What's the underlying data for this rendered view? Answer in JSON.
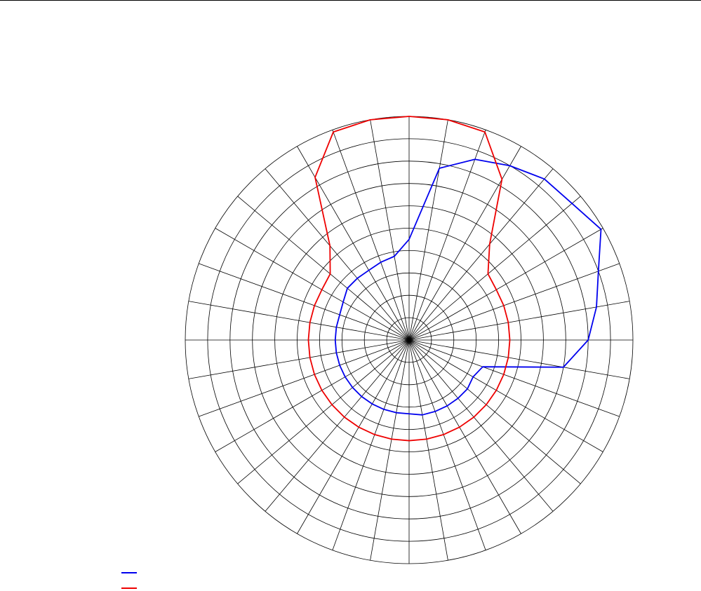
{
  "chart_data": {
    "type": "polar-line",
    "title": "",
    "theta_unit": "degrees",
    "theta_zero": "top",
    "theta_direction": "clockwise",
    "theta_step": 10,
    "r_rings": [
      1,
      2,
      3,
      4,
      5,
      6,
      7,
      8,
      9,
      10
    ],
    "r_max": 10,
    "grid": true,
    "legend_position": "bottom-left",
    "series": [
      {
        "name": "",
        "color": "#0000ee",
        "points": [
          {
            "theta": 0,
            "r": 4.5
          },
          {
            "theta": 10,
            "r": 7.8
          },
          {
            "theta": 20,
            "r": 8.6
          },
          {
            "theta": 30,
            "r": 9.0
          },
          {
            "theta": 40,
            "r": 9.4
          },
          {
            "theta": 50,
            "r": 9.5
          },
          {
            "theta": 60,
            "r": 9.9
          },
          {
            "theta": 70,
            "r": 9.0
          },
          {
            "theta": 80,
            "r": 8.5
          },
          {
            "theta": 90,
            "r": 8.0
          },
          {
            "theta": 100,
            "r": 7.0
          },
          {
            "theta": 110,
            "r": 3.5
          },
          {
            "theta": 120,
            "r": 3.3
          },
          {
            "theta": 130,
            "r": 3.4
          },
          {
            "theta": 140,
            "r": 3.4
          },
          {
            "theta": 150,
            "r": 3.4
          },
          {
            "theta": 160,
            "r": 3.4
          },
          {
            "theta": 170,
            "r": 3.4
          },
          {
            "theta": 180,
            "r": 3.3
          },
          {
            "theta": 190,
            "r": 3.3
          },
          {
            "theta": 200,
            "r": 3.3
          },
          {
            "theta": 210,
            "r": 3.3
          },
          {
            "theta": 220,
            "r": 3.3
          },
          {
            "theta": 230,
            "r": 3.3
          },
          {
            "theta": 240,
            "r": 3.3
          },
          {
            "theta": 250,
            "r": 3.3
          },
          {
            "theta": 260,
            "r": 3.3
          },
          {
            "theta": 270,
            "r": 3.3
          },
          {
            "theta": 280,
            "r": 3.3
          },
          {
            "theta": 290,
            "r": 3.3
          },
          {
            "theta": 300,
            "r": 3.4
          },
          {
            "theta": 310,
            "r": 3.6
          },
          {
            "theta": 320,
            "r": 3.6
          },
          {
            "theta": 330,
            "r": 3.6
          },
          {
            "theta": 340,
            "r": 3.7
          },
          {
            "theta": 350,
            "r": 3.8
          }
        ]
      },
      {
        "name": "",
        "color": "#ee0000",
        "points": [
          {
            "theta": 0,
            "r": 10.0
          },
          {
            "theta": 10,
            "r": 10.0
          },
          {
            "theta": 20,
            "r": 9.9
          },
          {
            "theta": 30,
            "r": 8.3
          },
          {
            "theta": 40,
            "r": 5.6
          },
          {
            "theta": 50,
            "r": 4.6
          },
          {
            "theta": 60,
            "r": 4.5
          },
          {
            "theta": 70,
            "r": 4.5
          },
          {
            "theta": 80,
            "r": 4.5
          },
          {
            "theta": 90,
            "r": 4.5
          },
          {
            "theta": 100,
            "r": 4.5
          },
          {
            "theta": 110,
            "r": 4.5
          },
          {
            "theta": 120,
            "r": 4.5
          },
          {
            "theta": 130,
            "r": 4.5
          },
          {
            "theta": 140,
            "r": 4.5
          },
          {
            "theta": 150,
            "r": 4.5
          },
          {
            "theta": 160,
            "r": 4.5
          },
          {
            "theta": 170,
            "r": 4.5
          },
          {
            "theta": 180,
            "r": 4.5
          },
          {
            "theta": 190,
            "r": 4.5
          },
          {
            "theta": 200,
            "r": 4.5
          },
          {
            "theta": 210,
            "r": 4.5
          },
          {
            "theta": 220,
            "r": 4.5
          },
          {
            "theta": 230,
            "r": 4.5
          },
          {
            "theta": 240,
            "r": 4.5
          },
          {
            "theta": 250,
            "r": 4.5
          },
          {
            "theta": 260,
            "r": 4.5
          },
          {
            "theta": 270,
            "r": 4.5
          },
          {
            "theta": 280,
            "r": 4.5
          },
          {
            "theta": 290,
            "r": 4.5
          },
          {
            "theta": 300,
            "r": 4.5
          },
          {
            "theta": 310,
            "r": 4.6
          },
          {
            "theta": 320,
            "r": 5.5
          },
          {
            "theta": 330,
            "r": 8.4
          },
          {
            "theta": 340,
            "r": 9.9
          },
          {
            "theta": 350,
            "r": 10.0
          }
        ]
      }
    ]
  }
}
